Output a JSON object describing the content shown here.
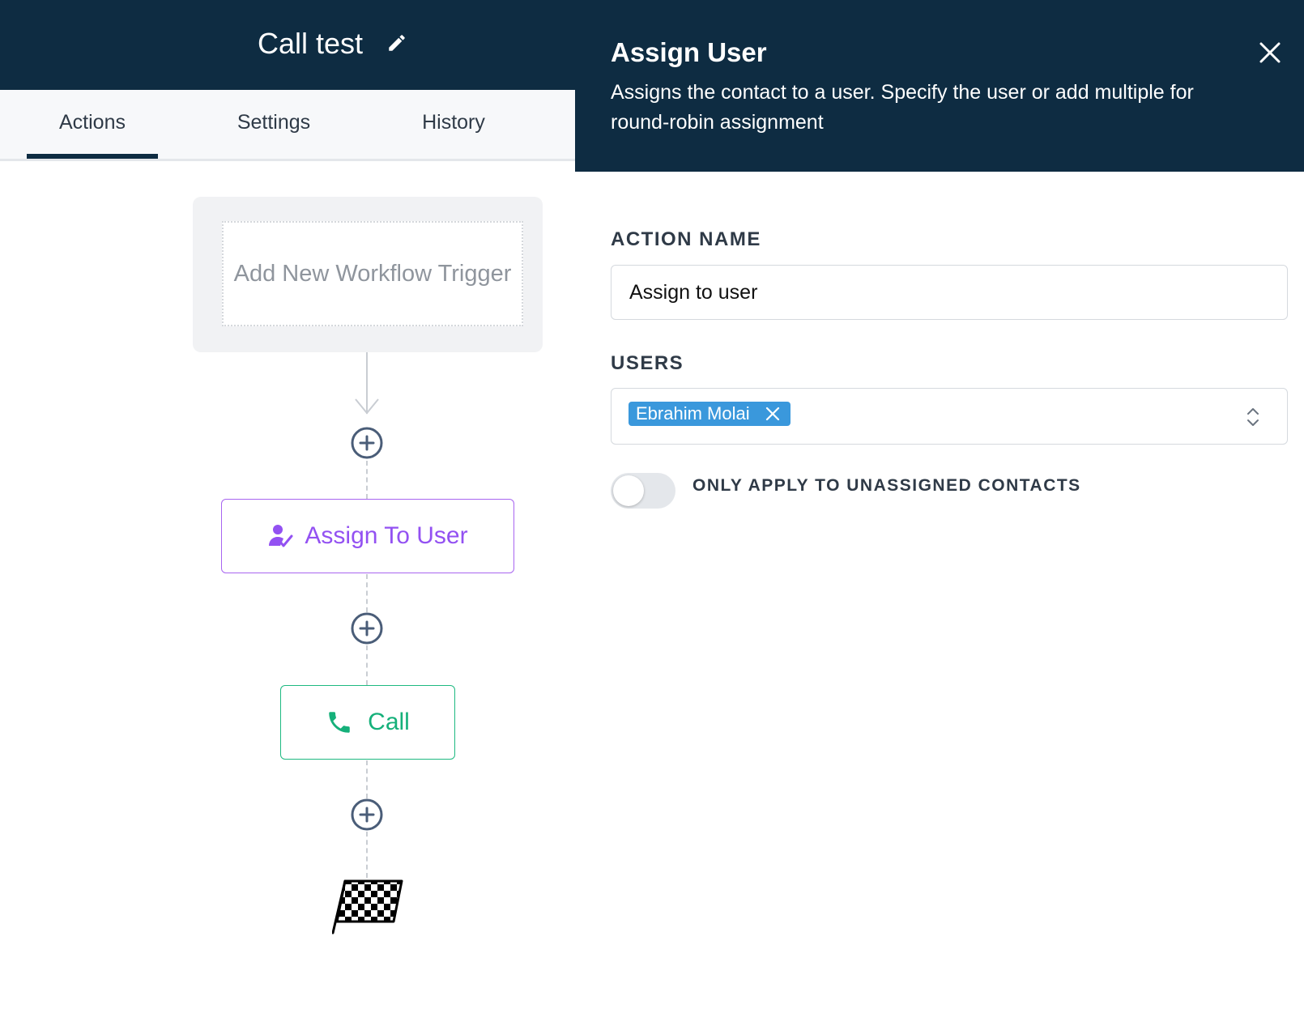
{
  "workflow": {
    "title": "Call test"
  },
  "tabs": [
    {
      "label": "Actions",
      "active": true
    },
    {
      "label": "Settings",
      "active": false
    },
    {
      "label": "History",
      "active": false
    }
  ],
  "builder": {
    "trigger_placeholder": "Add New Workflow Trigger",
    "actions": [
      {
        "label": "Assign To User",
        "icon": "user-check-icon",
        "color": "#9351f2"
      },
      {
        "label": "Call",
        "icon": "phone-icon",
        "color": "#15b07a"
      }
    ],
    "end_icon": "checkered-flag-icon"
  },
  "panel": {
    "title": "Assign User",
    "description": "Assigns the contact to a user. Specify the user or add multiple for round-robin assignment",
    "action_name_label": "ACTION NAME",
    "action_name_value": "Assign to user",
    "users_label": "USERS",
    "selected_users": [
      "Ebrahim Molai"
    ],
    "toggle_label": "ONLY APPLY TO UNASSIGNED CONTACTS",
    "toggle_on": false
  },
  "colors": {
    "header_bg": "#0e2c42",
    "chip_bg": "#3a98dc",
    "assign_accent": "#9351f2",
    "call_accent": "#15b07a"
  }
}
